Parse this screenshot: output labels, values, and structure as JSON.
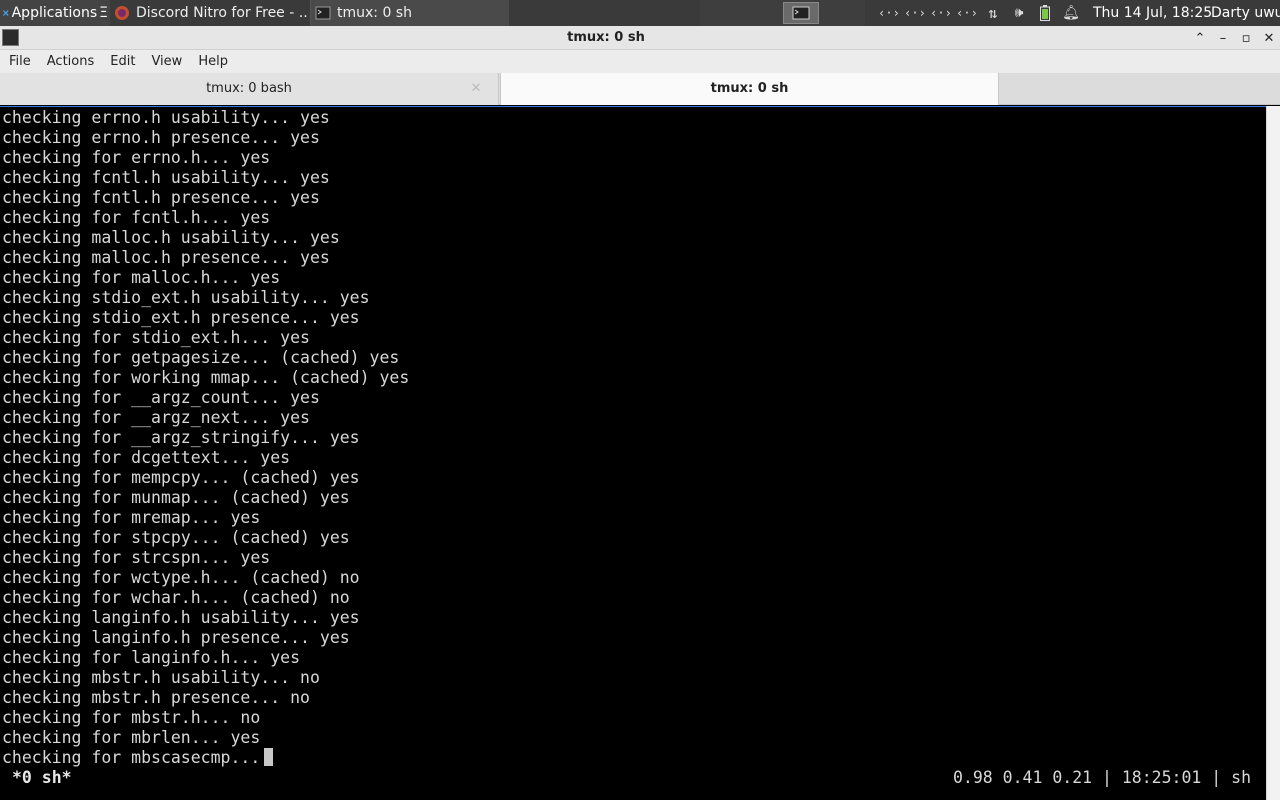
{
  "panel": {
    "applications_label": "Applications",
    "tasks": [
      {
        "label": "Discord Nitro for Free - ..."
      },
      {
        "label": "tmux: 0 sh"
      }
    ],
    "tray_icons": [
      "network-icon",
      "network-icon",
      "network-icon",
      "network-icon",
      "transfer-icon",
      "volume-icon",
      "battery-icon",
      "bell-icon"
    ],
    "clock": "Thu 14 Jul, 18:25",
    "user": "Darty uwu"
  },
  "window": {
    "title": "tmux: 0 sh"
  },
  "menu": {
    "items": [
      "File",
      "Actions",
      "Edit",
      "View",
      "Help"
    ]
  },
  "tabs": [
    {
      "label": "tmux: 0 bash"
    },
    {
      "label": "tmux: 0 sh"
    }
  ],
  "terminal": {
    "lines": [
      "checking errno.h usability... yes",
      "checking errno.h presence... yes",
      "checking for errno.h... yes",
      "checking fcntl.h usability... yes",
      "checking fcntl.h presence... yes",
      "checking for fcntl.h... yes",
      "checking malloc.h usability... yes",
      "checking malloc.h presence... yes",
      "checking for malloc.h... yes",
      "checking stdio_ext.h usability... yes",
      "checking stdio_ext.h presence... yes",
      "checking for stdio_ext.h... yes",
      "checking for getpagesize... (cached) yes",
      "checking for working mmap... (cached) yes",
      "checking for __argz_count... yes",
      "checking for __argz_next... yes",
      "checking for __argz_stringify... yes",
      "checking for dcgettext... yes",
      "checking for mempcpy... (cached) yes",
      "checking for munmap... (cached) yes",
      "checking for mremap... yes",
      "checking for stpcpy... (cached) yes",
      "checking for strcspn... yes",
      "checking for wctype.h... (cached) no",
      "checking for wchar.h... (cached) no",
      "checking langinfo.h usability... yes",
      "checking langinfo.h presence... yes",
      "checking for langinfo.h... yes",
      "checking mbstr.h usability... no",
      "checking mbstr.h presence... no",
      "checking for mbstr.h... no",
      "checking for mbrlen... yes",
      "checking for mbscasecmp..."
    ],
    "status_left": "*0 sh*",
    "status_right": "0.98 0.41 0.21 | 18:25:01 | sh"
  }
}
